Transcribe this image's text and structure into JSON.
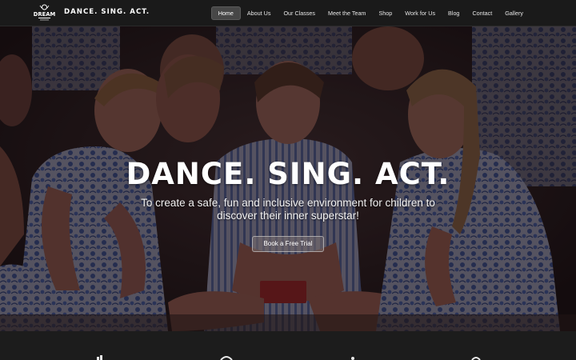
{
  "header": {
    "logo_text_top": "DREAM",
    "brand": "DANCE. SING. ACT."
  },
  "nav": {
    "items": [
      {
        "label": "Home",
        "active": true
      },
      {
        "label": "About Us"
      },
      {
        "label": "Our Classes"
      },
      {
        "label": "Meet the Team"
      },
      {
        "label": "Shop"
      },
      {
        "label": "Work for Us"
      },
      {
        "label": "Blog"
      },
      {
        "label": "Contact"
      },
      {
        "label": "Gallery"
      }
    ]
  },
  "hero": {
    "title": "DANCE. SING. ACT.",
    "subtitle": "To create a safe, fun and inclusive environment for children to discover their inner superstar!",
    "cta_label": "Book a Free Trial"
  },
  "colors": {
    "header_bg": "#1a1a1a",
    "hero_overlay": "#140c0e",
    "dress_blue": "#3a4f86",
    "skin": "#7a4a45",
    "footer_bg": "#1c1c1c"
  },
  "icons": [
    "dance-icon",
    "sing-icon",
    "act-icon",
    "music-icon"
  ]
}
